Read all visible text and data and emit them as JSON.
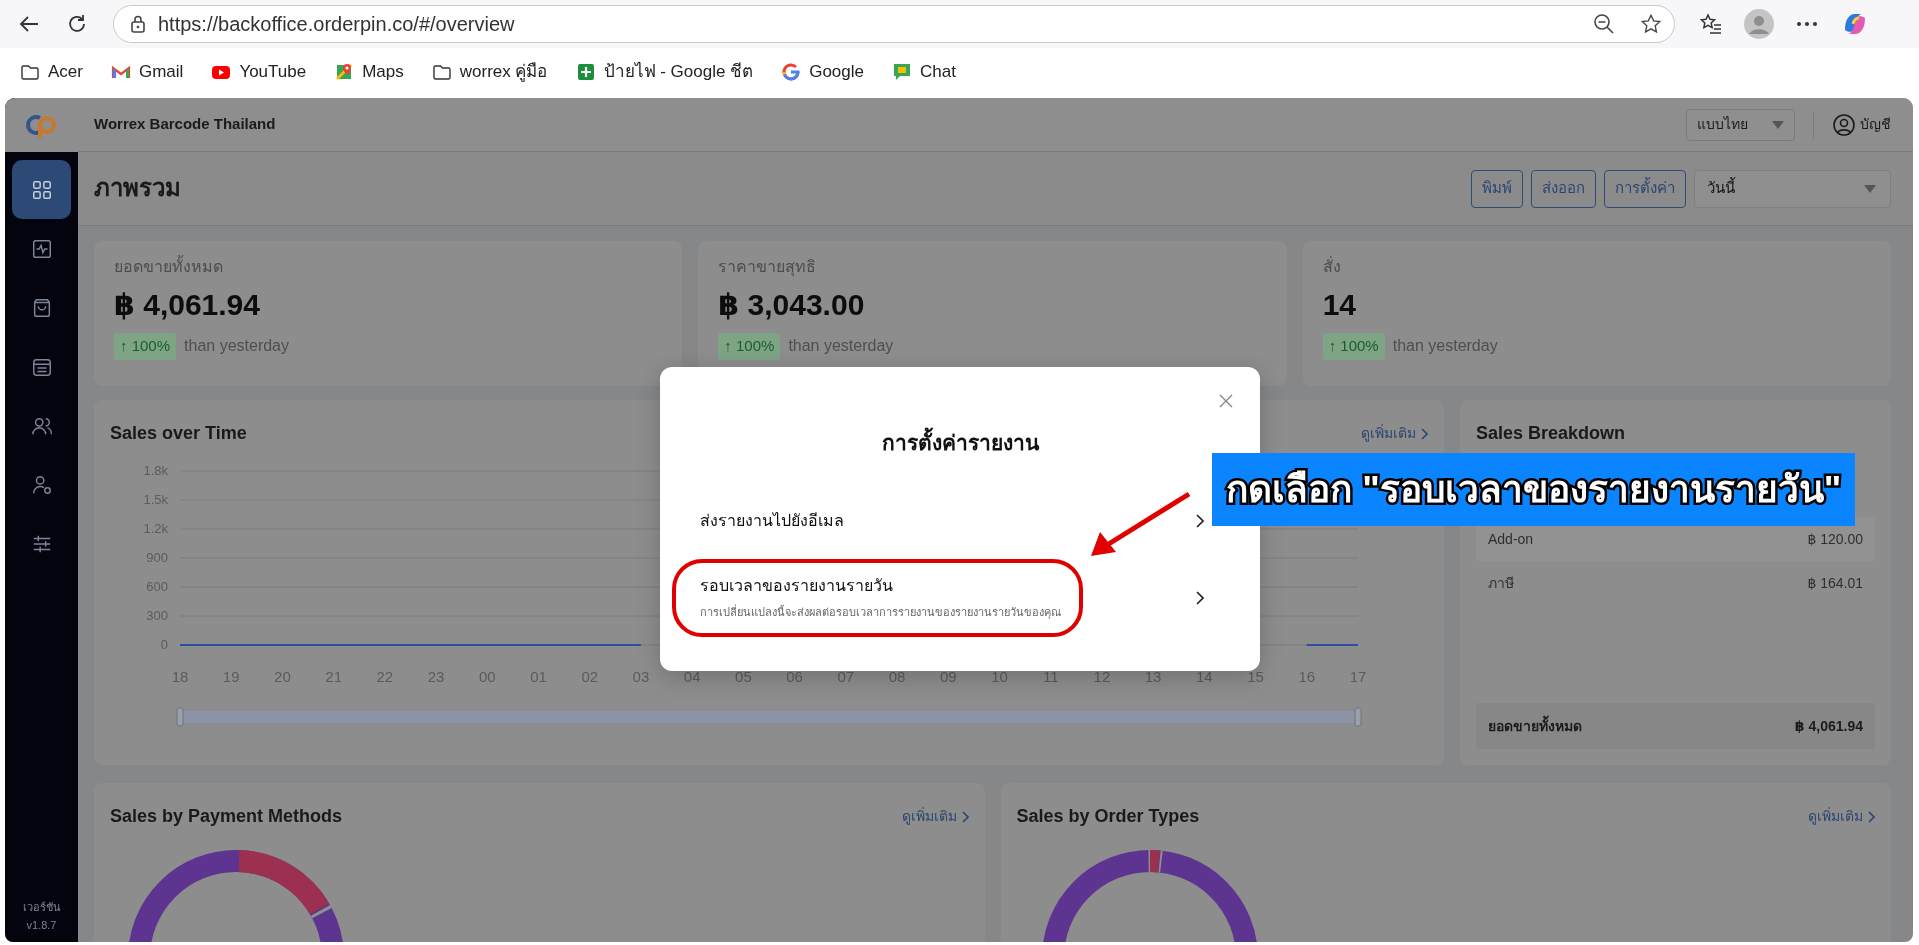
{
  "browser": {
    "url": "https://backoffice.orderpin.co/#/overview",
    "bookmarks": [
      {
        "label": "Acer",
        "kind": "folder"
      },
      {
        "label": "Gmail",
        "kind": "gmail"
      },
      {
        "label": "YouTube",
        "kind": "youtube"
      },
      {
        "label": "Maps",
        "kind": "maps"
      },
      {
        "label": "worrex คู่มือ",
        "kind": "folder"
      },
      {
        "label": "ป้ายไฟ - Google ชีต",
        "kind": "sheets"
      },
      {
        "label": "Google",
        "kind": "google"
      },
      {
        "label": "Chat",
        "kind": "chat"
      }
    ]
  },
  "app": {
    "company": "Worrex Barcode Thailand",
    "language": "แบบไทย",
    "account": "บัญชี",
    "version_label": "เวอร์ชัน",
    "version": "v1.8.7"
  },
  "sidebar": {
    "items": [
      {
        "kind": "grid",
        "selected": true
      },
      {
        "kind": "pulse",
        "selected": false
      },
      {
        "kind": "bag",
        "selected": false
      },
      {
        "kind": "archive",
        "selected": false
      },
      {
        "kind": "users",
        "selected": false
      },
      {
        "kind": "user",
        "selected": false
      },
      {
        "kind": "sliders",
        "selected": false
      }
    ]
  },
  "page": {
    "title": "ภาพรวม",
    "actions": [
      "พิมพ์",
      "ส่งออก",
      "การตั้งค่า"
    ],
    "period": "วันนี้"
  },
  "stats": [
    {
      "label": "ยอดขายทั้งหมด",
      "value": "฿ 4,061.94",
      "change": "↑ 100%",
      "comparison": "than yesterday"
    },
    {
      "label": "ราคาขายสุทธิ",
      "value": "฿ 3,043.00",
      "change": "↑ 100%",
      "comparison": "than yesterday"
    },
    {
      "label": "สั่ง",
      "value": "14",
      "change": "↑ 100%",
      "comparison": "than yesterday"
    }
  ],
  "sales_over_time": {
    "title": "Sales over Time",
    "more": "ดูเพิ่มเติม",
    "chart_data": {
      "type": "line",
      "categories": [
        "18",
        "19",
        "20",
        "21",
        "22",
        "23",
        "00",
        "01",
        "02",
        "03",
        "04",
        "05",
        "06",
        "07",
        "08",
        "09",
        "10",
        "11",
        "12",
        "13",
        "14",
        "15",
        "16",
        "17"
      ],
      "series": [
        {
          "color": "#2d4f9e",
          "values": [
            0,
            0,
            0,
            0,
            0,
            0,
            0,
            0,
            0,
            0,
            null,
            null,
            null,
            null,
            null,
            null,
            null,
            null,
            null,
            null,
            null,
            null,
            0,
            0
          ]
        }
      ],
      "grid": true,
      "ylim": [
        0,
        1800
      ],
      "yticks": [
        {
          "value": 0,
          "label": "0"
        },
        {
          "value": 300,
          "label": "300"
        },
        {
          "value": 600,
          "label": "600"
        },
        {
          "value": 900,
          "label": "900"
        },
        {
          "value": 1200,
          "label": "1.2k"
        },
        {
          "value": 1500,
          "label": "1.5k"
        },
        {
          "value": 1800,
          "label": "1.8k"
        }
      ]
    }
  },
  "sales_breakdown": {
    "title": "Sales Breakdown",
    "rows": [
      {
        "label": "Add-on",
        "amount": "฿ 120.00"
      },
      {
        "label": "ภาษี",
        "amount": "฿ 164.01"
      }
    ],
    "total": {
      "label": "ยอดขายทั้งหมด",
      "amount": "฿ 4,061.94"
    }
  },
  "payment_methods": {
    "title": "Sales by Payment Methods",
    "more": "ดูเพิ่มเติม"
  },
  "order_types": {
    "title": "Sales by Order Types",
    "more": "ดูเพิ่มเติม"
  },
  "modal": {
    "title": "การตั้งค่ารายงาน",
    "items": [
      {
        "title": "ส่งรายงานไปยังอีเมล",
        "highlighted": false
      },
      {
        "title": "รอบเวลาของรายงานรายวัน",
        "description": "การเปลี่ยนแปลงนี้จะส่งผลต่อรอบเวลาการรายงานของรายงานรายวันของคุณ",
        "highlighted": true
      }
    ]
  },
  "annotation": {
    "callout": "กดเลือก \"รอบเวลาของรายงานรายวัน\""
  }
}
